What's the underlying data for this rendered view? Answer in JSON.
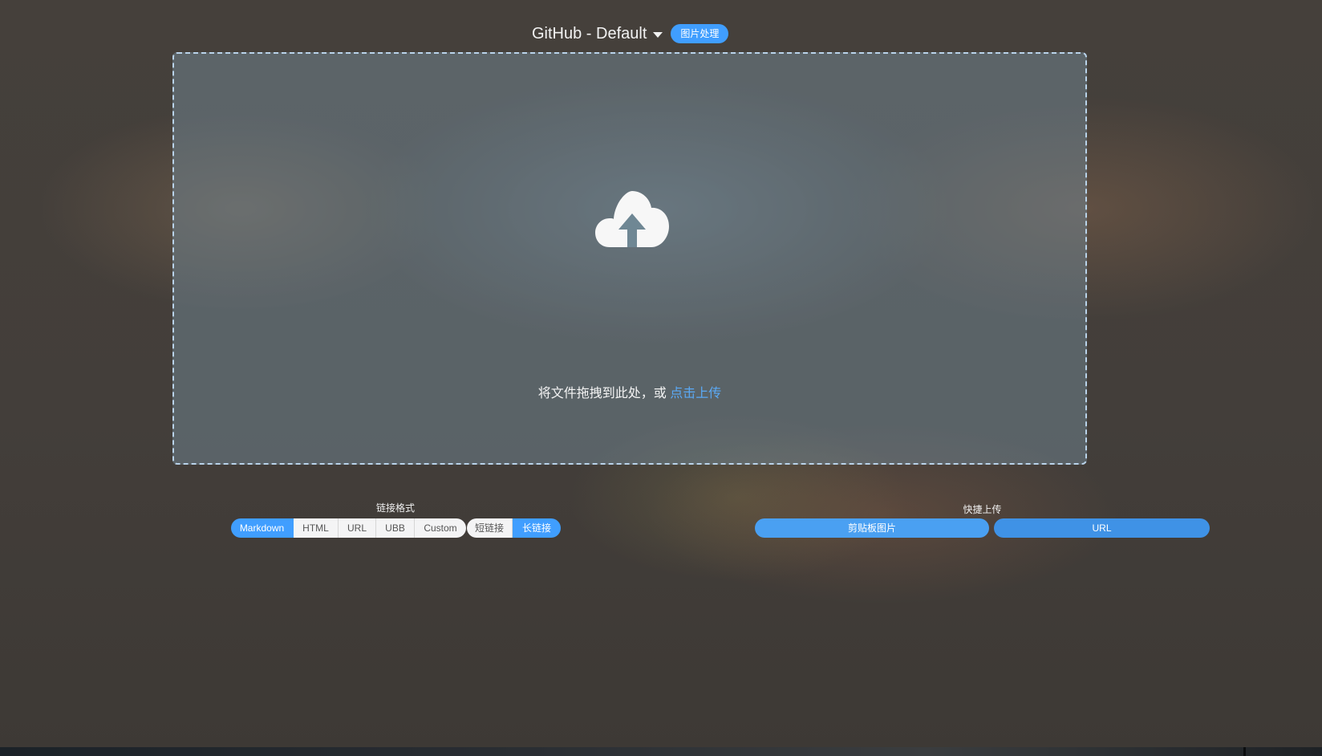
{
  "header": {
    "picbed_name": "GitHub - Default",
    "image_process_label": "图片处理"
  },
  "upload": {
    "icon": "cloud-upload-icon",
    "drag_text": "将文件拖拽到此处，或",
    "click_text": "点击上传"
  },
  "link_format": {
    "label": "链接格式",
    "formats": [
      "Markdown",
      "HTML",
      "URL",
      "UBB",
      "Custom"
    ],
    "selected_format": "Markdown",
    "lengths": [
      "短链接",
      "长链接"
    ],
    "selected_length": "长链接"
  },
  "quick_upload": {
    "label": "快捷上传",
    "clipboard_label": "剪贴板图片",
    "url_label": "URL"
  },
  "colors": {
    "accent": "#409eff",
    "link": "#5aa9f5"
  }
}
